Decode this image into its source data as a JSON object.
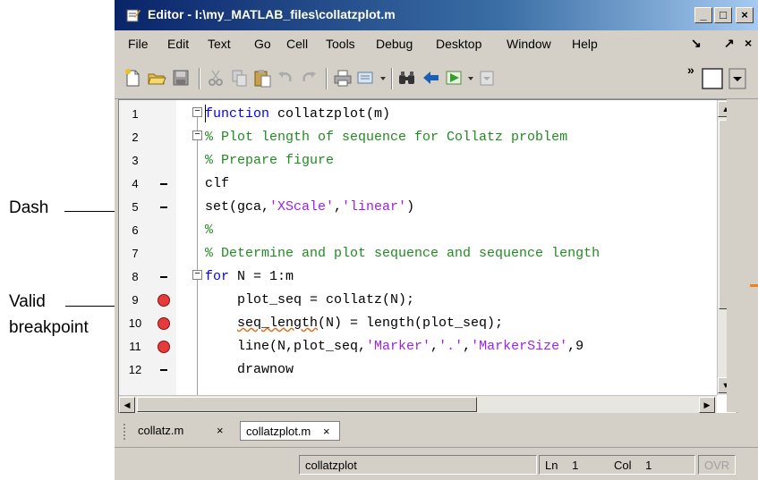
{
  "window": {
    "title": "Editor - I:\\my_MATLAB_files\\collatzplot.m",
    "minimize": "_",
    "maximize": "□",
    "close": "×"
  },
  "menu": {
    "items": [
      "File",
      "Edit",
      "Text",
      "Go",
      "Cell",
      "Tools",
      "Debug",
      "Desktop",
      "Window",
      "Help"
    ],
    "dock_glyph": "↘",
    "undock_glyph": "↗",
    "close_glyph": "×"
  },
  "toolbar": {
    "icons": [
      "new-file-icon",
      "open-folder-icon",
      "save-icon",
      "cut-icon",
      "copy-icon",
      "paste-icon",
      "undo-icon",
      "redo-icon",
      "print-icon",
      "format-icon",
      "find-icon",
      "back-icon",
      "run-icon"
    ],
    "overflow": "»"
  },
  "callouts": {
    "dash": "Dash",
    "valid_breakpoint_1": "Valid",
    "valid_breakpoint_2": "breakpoint"
  },
  "editor": {
    "lines": [
      {
        "num": "1",
        "marker": "none",
        "segments": [
          {
            "t": "function",
            "c": "kw"
          },
          {
            "t": " collatzplot(m)",
            "c": "txt"
          }
        ]
      },
      {
        "num": "2",
        "marker": "none",
        "segments": [
          {
            "t": "% Plot length of sequence for Collatz problem",
            "c": "cm"
          }
        ]
      },
      {
        "num": "3",
        "marker": "none",
        "segments": [
          {
            "t": "% Prepare figure",
            "c": "cm"
          }
        ]
      },
      {
        "num": "4",
        "marker": "dash",
        "segments": [
          {
            "t": "clf",
            "c": "txt"
          }
        ]
      },
      {
        "num": "5",
        "marker": "dash",
        "segments": [
          {
            "t": "set(gca,",
            "c": "txt"
          },
          {
            "t": "'XScale'",
            "c": "str"
          },
          {
            "t": ",",
            "c": "txt"
          },
          {
            "t": "'linear'",
            "c": "str"
          },
          {
            "t": ")",
            "c": "txt"
          }
        ]
      },
      {
        "num": "6",
        "marker": "none",
        "segments": [
          {
            "t": "%",
            "c": "cm"
          }
        ]
      },
      {
        "num": "7",
        "marker": "none",
        "segments": [
          {
            "t": "% Determine and plot sequence and sequence length",
            "c": "cm"
          }
        ]
      },
      {
        "num": "8",
        "marker": "dash",
        "segments": [
          {
            "t": "for",
            "c": "kw"
          },
          {
            "t": " N = 1:m",
            "c": "txt"
          }
        ]
      },
      {
        "num": "9",
        "marker": "breakpoint",
        "segments": [
          {
            "t": "    plot_seq = collatz(N);",
            "c": "txt"
          }
        ]
      },
      {
        "num": "10",
        "marker": "breakpoint",
        "segments": [
          {
            "t": "    ",
            "c": "txt"
          },
          {
            "t": "seq_length",
            "c": "sq"
          },
          {
            "t": "(N) = length(plot_seq);",
            "c": "txt"
          }
        ]
      },
      {
        "num": "11",
        "marker": "breakpoint",
        "segments": [
          {
            "t": "    line(N,plot_seq,",
            "c": "txt"
          },
          {
            "t": "'Marker'",
            "c": "str"
          },
          {
            "t": ",",
            "c": "txt"
          },
          {
            "t": "'.'",
            "c": "str"
          },
          {
            "t": ",",
            "c": "txt"
          },
          {
            "t": "'MarkerSize'",
            "c": "str"
          },
          {
            "t": ",9",
            "c": "txt"
          }
        ]
      },
      {
        "num": "12",
        "marker": "dash",
        "segments": [
          {
            "t": "    drawnow",
            "c": "txt"
          }
        ]
      }
    ]
  },
  "tabs": [
    {
      "label": "collatz.m",
      "close": "×",
      "active": false
    },
    {
      "label": "collatzplot.m",
      "close": "×",
      "active": true
    }
  ],
  "status": {
    "function_name": "collatzplot",
    "ln_label": "Ln",
    "ln_value": "1",
    "col_label": "Col",
    "col_value": "1",
    "mode": "OVR"
  }
}
